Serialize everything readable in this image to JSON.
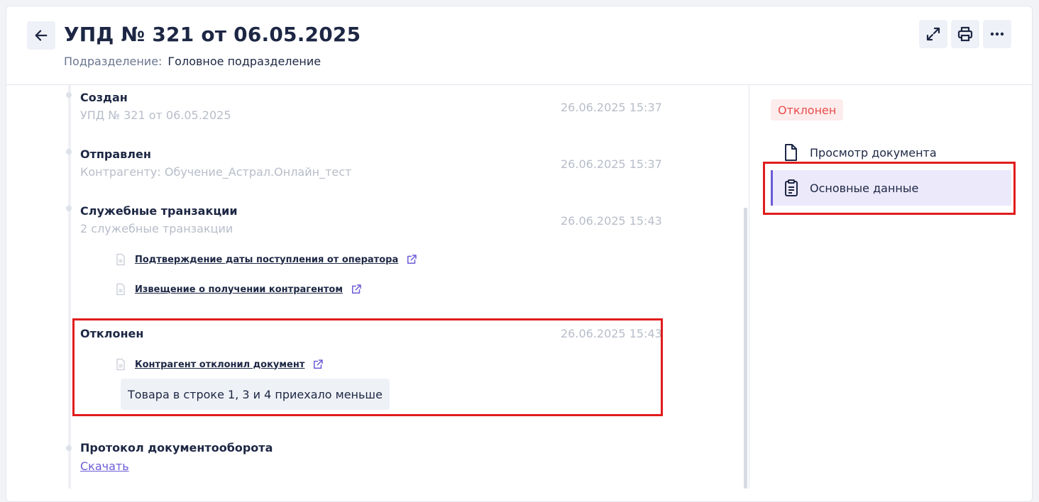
{
  "header": {
    "title": "УПД № 321 от 06.05.2025",
    "subdivision_label": "Подразделение:",
    "subdivision_value": "Головное подразделение"
  },
  "timeline": [
    {
      "title": "Создан",
      "subtitle": "УПД № 321 от 06.05.2025",
      "time": "26.06.2025 15:37"
    },
    {
      "title": "Отправлен",
      "subtitle": "Контрагенту: Обучение_Астрал.Онлайн_тест",
      "time": "26.06.2025 15:37"
    },
    {
      "title": "Служебные транзакции",
      "subtitle": "2 служебные транзакции",
      "time": "26.06.2025 15:43",
      "links": [
        "Подтверждение даты поступления от оператора",
        "Извещение о получении контрагентом"
      ]
    },
    {
      "title": "Отклонен",
      "time": "26.06.2025 15:43",
      "links": [
        "Контрагент отклонил документ"
      ],
      "comment": "Товара в строке 1, 3 и 4 приехало меньше"
    },
    {
      "title": "Протокол документооборота",
      "link": "Скачать"
    }
  ],
  "sidebar": {
    "status": "Отклонен",
    "items": [
      {
        "label": "Просмотр документа",
        "icon": "file-icon"
      },
      {
        "label": "Основные данные",
        "icon": "clipboard-icon",
        "active": true
      }
    ]
  },
  "colors": {
    "accent": "#6b5bd6",
    "status_rejected": "#e84c4c",
    "highlight_frame": "#e01c1c"
  }
}
